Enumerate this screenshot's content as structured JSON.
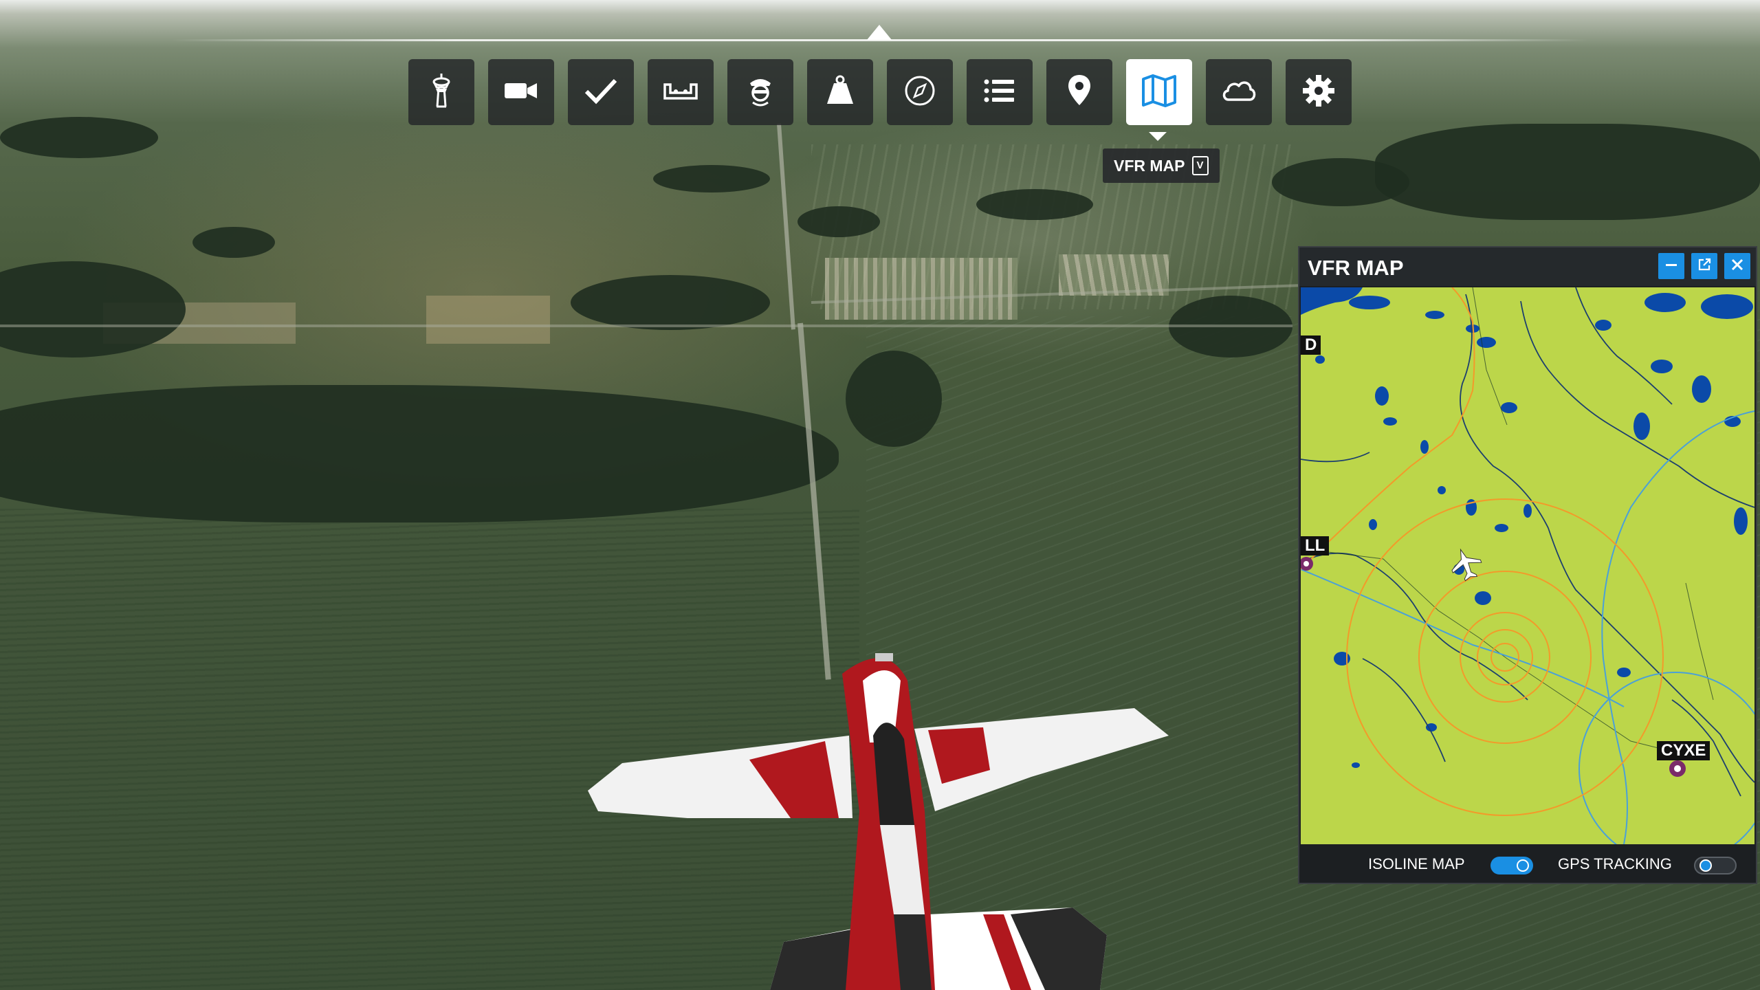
{
  "toolbar": {
    "buttons": [
      {
        "icon": "atc-tower-icon",
        "active": false
      },
      {
        "icon": "camera-icon",
        "active": false
      },
      {
        "icon": "checklist-icon",
        "active": false
      },
      {
        "icon": "controls-icon",
        "active": false
      },
      {
        "icon": "pilot-icon",
        "active": false
      },
      {
        "icon": "weight-icon",
        "active": false
      },
      {
        "icon": "navlog-icon",
        "active": false
      },
      {
        "icon": "objectives-icon",
        "active": false
      },
      {
        "icon": "location-pin-icon",
        "active": false
      },
      {
        "icon": "vfr-map-icon",
        "active": true
      },
      {
        "icon": "weather-icon",
        "active": false
      },
      {
        "icon": "settings-icon",
        "active": false
      }
    ],
    "tooltip": {
      "label": "VFR MAP",
      "shortcut": "V"
    }
  },
  "vfr_map": {
    "title": "VFR MAP",
    "labels": {
      "top_left": "D",
      "left": "LL",
      "airport": "CYXE"
    },
    "footer": {
      "isoline_label": "ISOLINE MAP",
      "isoline_on": true,
      "gps_label": "GPS TRACKING",
      "gps_on": false
    }
  },
  "colors": {
    "accent": "#1a8fe3",
    "map_land": "#bcd64a",
    "map_water": "#0b4aa8",
    "range_ring": "#f39a2a",
    "panel_bg": "#1c1f22"
  }
}
